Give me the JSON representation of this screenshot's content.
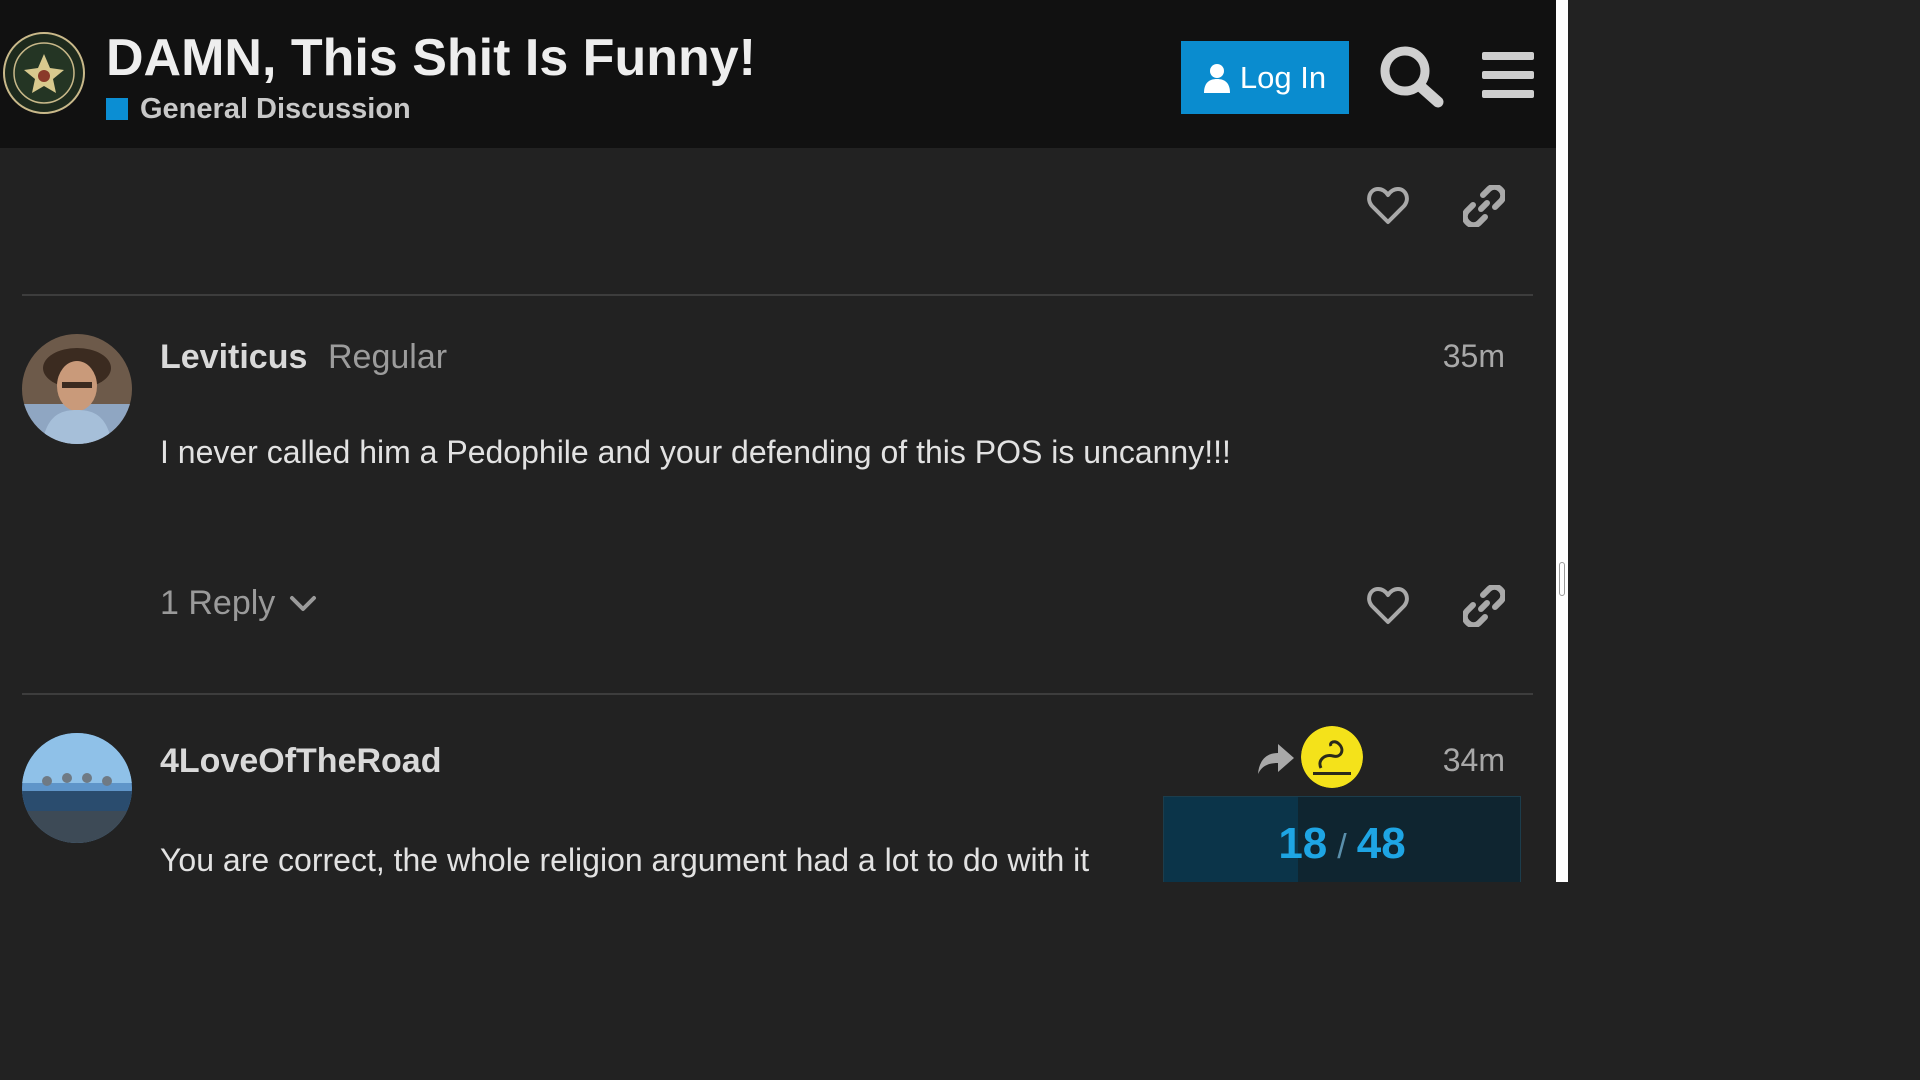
{
  "header": {
    "title": "DAMN, This Shit Is Funny!",
    "category": "General Discussion",
    "category_color": "#0b8ed3",
    "login_label": "Log In"
  },
  "posts": [
    {
      "username": "Leviticus",
      "user_title": "Regular",
      "time": "35m",
      "body": "I never called him a Pedophile and your defending of this POS is uncanny!!!",
      "replies_label": "1 Reply"
    },
    {
      "username": "4LoveOfTheRoad",
      "time": "34m",
      "body": "You are correct, the whole religion argument had a lot to do with it"
    }
  ],
  "progress": {
    "current": "18",
    "total": "48",
    "separator": "/"
  },
  "icons": [
    "heart-icon",
    "link-icon",
    "search-icon",
    "hamburger-menu-icon",
    "user-icon",
    "chevron-down-icon",
    "reply-arrow-icon"
  ]
}
